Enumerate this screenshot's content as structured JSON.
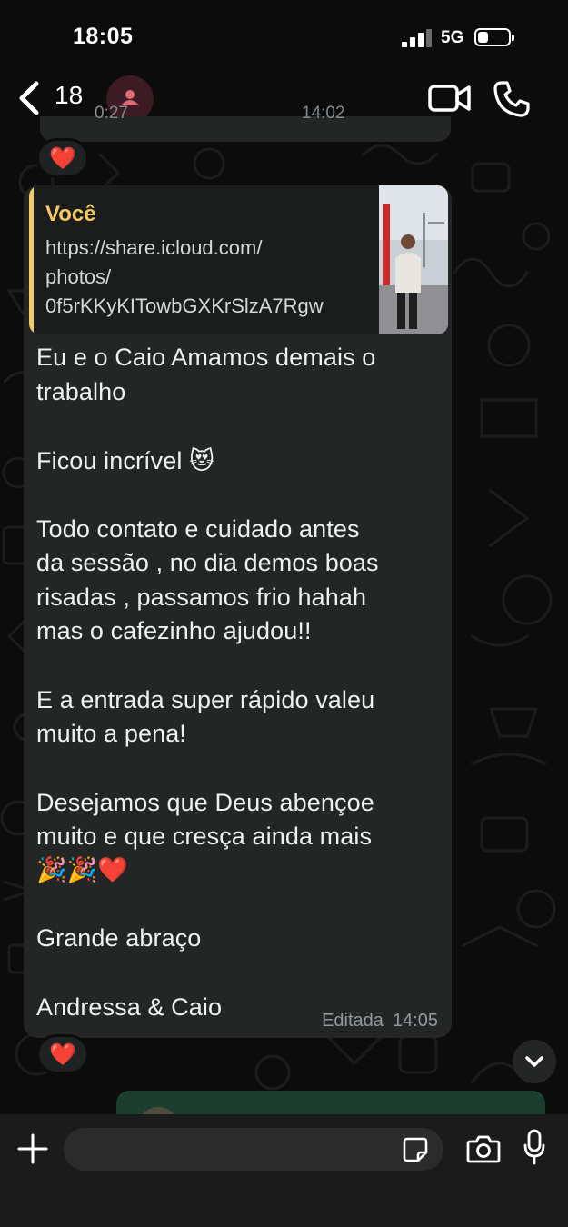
{
  "status_bar": {
    "time": "18:05",
    "network": "5G",
    "signal_bars": 3,
    "battery_level": 0.35
  },
  "header": {
    "unread_count": "18",
    "back_icon": "chevron-left-icon",
    "avatar_icon": "person-icon",
    "video_icon": "video-camera-icon",
    "call_icon": "phone-icon"
  },
  "previous_message": {
    "time_left": "0:27",
    "time_right": "14:02",
    "reaction": "❤️"
  },
  "message": {
    "quote": {
      "author": "Você",
      "lines": [
        "https://share.icloud.com/",
        "photos/",
        "0f5rKKyKITowbGXKrSlzA7Rgw"
      ]
    },
    "lines": [
      "Eu e o Caio Amamos demais o",
      "trabalho",
      "Ficou incrível 😻",
      "Todo contato e cuidado antes",
      "da sessão , no dia demos boas",
      "risadas , passamos frio hahah",
      "mas o cafezinho ajudou!!",
      "E a entrada super rápido valeu",
      "muito a pena!",
      "Desejamos que Deus abençoe",
      "muito e que cresça ainda mais",
      "🎉🎉❤️",
      "Grande abraço",
      "Andressa & Caio"
    ],
    "edited_label": "Editada",
    "time": "14:05",
    "reaction": "❤️"
  },
  "composer": {
    "plus_icon": "plus-icon",
    "input_value": "",
    "sticker_icon": "sticker-icon",
    "camera_icon": "camera-icon",
    "mic_icon": "microphone-icon"
  },
  "colors": {
    "background": "#0c0c0c",
    "bubble": "#242626",
    "quote_accent": "#f5c964",
    "outgoing_bubble": "#1c3e2e",
    "avatar_bg": "#3d1b22",
    "avatar_icon": "#e06a78"
  }
}
